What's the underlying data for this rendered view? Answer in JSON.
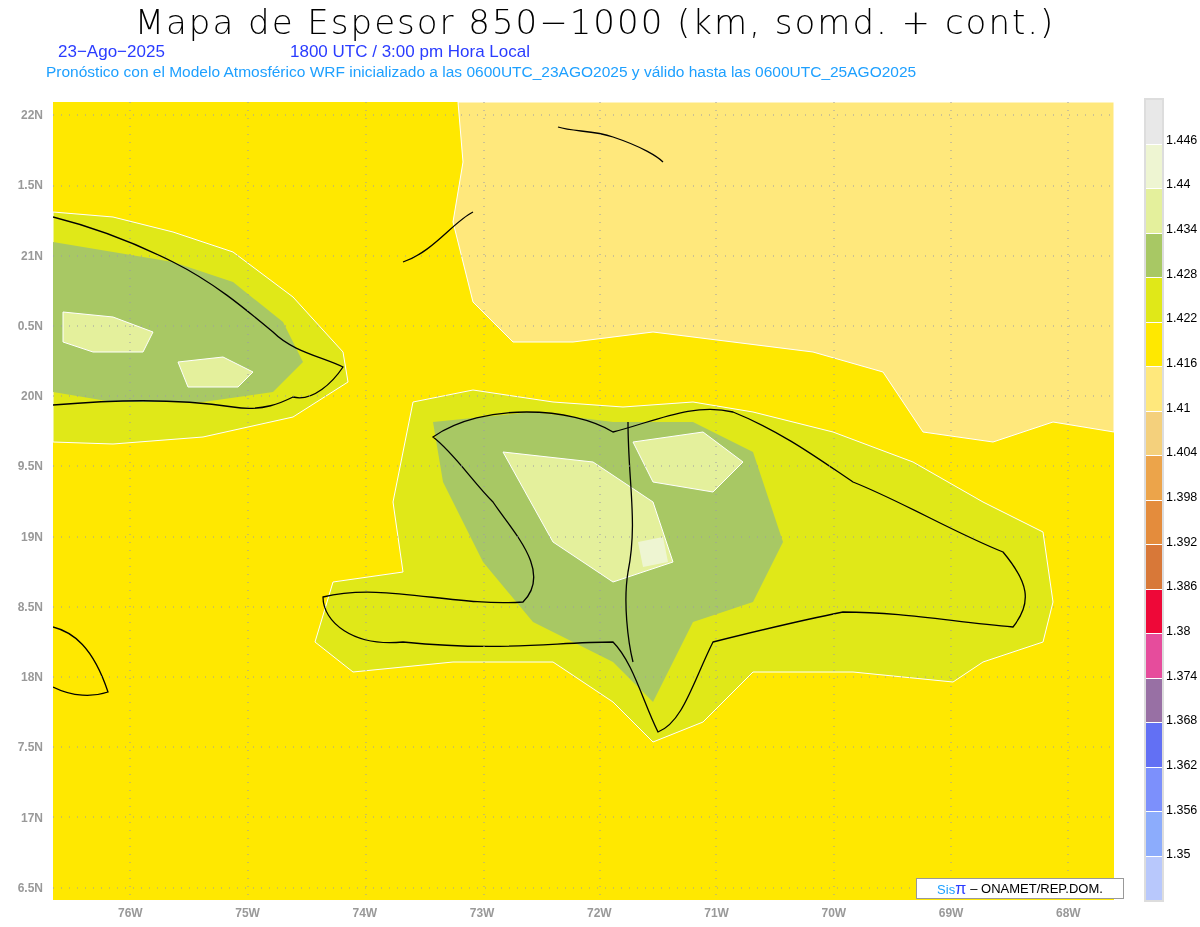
{
  "title": "Mapa de Espesor 850−1000 (km, somd. + cont.)",
  "date": "23−Ago−2025",
  "time": "1800 UTC / 3:00 pm Hora Local",
  "description": "Pronóstico con el Modelo Atmosférico WRF inicializado a las 0600UTC_23AGO2025 y válido hasta las  0600UTC_25AGO2025",
  "y_axis": [
    "22N",
    "1.5N",
    "21N",
    "0.5N",
    "20N",
    "9.5N",
    "19N",
    "8.5N",
    "18N",
    "7.5N",
    "17N",
    "6.5N"
  ],
  "x_axis": [
    "76W",
    "75W",
    "74W",
    "73W",
    "72W",
    "71W",
    "70W",
    "69W",
    "68W"
  ],
  "legend": [
    {
      "color": "#e8e8e8",
      "label": "1.446"
    },
    {
      "color": "#eef5d2",
      "label": "1.44"
    },
    {
      "color": "#e4f09c",
      "label": "1.434"
    },
    {
      "color": "#a8c864",
      "label": "1.428"
    },
    {
      "color": "#e0e818",
      "label": "1.422"
    },
    {
      "color": "#ffe800",
      "label": "1.416"
    },
    {
      "color": "#ffe87c",
      "label": "1.41"
    },
    {
      "color": "#f4d07c",
      "label": "1.404"
    },
    {
      "color": "#eca44a",
      "label": "1.398"
    },
    {
      "color": "#e48c3c",
      "label": "1.392"
    },
    {
      "color": "#d87838",
      "label": "1.386"
    },
    {
      "color": "#ee0838",
      "label": "1.38"
    },
    {
      "color": "#e64c9c",
      "label": "1.374"
    },
    {
      "color": "#9870a4",
      "label": "1.368"
    },
    {
      "color": "#6270f4",
      "label": "1.362"
    },
    {
      "color": "#7c90fc",
      "label": "1.356"
    },
    {
      "color": "#8cacfc",
      "label": "1.35"
    },
    {
      "color": "#b8c8fc"
    }
  ],
  "credit": {
    "brand": "Sis",
    "symbol": "π",
    "text": "– ONAMET/REP.DOM."
  }
}
